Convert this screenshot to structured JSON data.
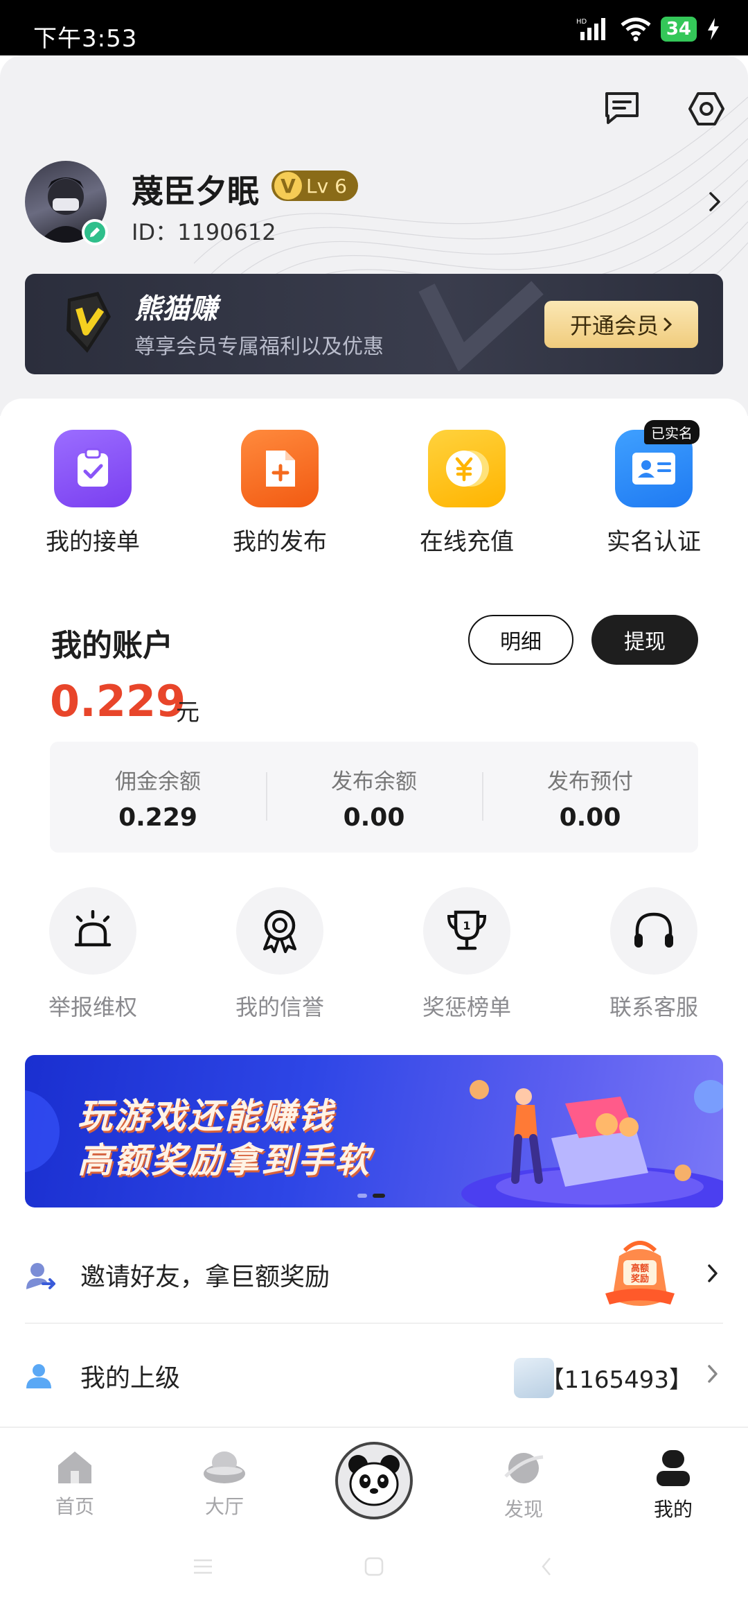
{
  "status_bar": {
    "time": "下午3:53",
    "battery": "34"
  },
  "profile": {
    "name": "蔑臣夕眠",
    "level": "Lv 6",
    "vip_letter": "V",
    "id_label": "ID：1190612"
  },
  "vip": {
    "title": "熊猫赚",
    "subtitle": "尊享会员专属福利以及优惠",
    "button": "开通会员"
  },
  "quick_actions": [
    {
      "label": "我的接单",
      "icon": "clipboard-check-icon"
    },
    {
      "label": "我的发布",
      "icon": "document-add-icon"
    },
    {
      "label": "在线充值",
      "icon": "yuan-coin-icon"
    },
    {
      "label": "实名认证",
      "icon": "id-card-icon",
      "tag": "已实名"
    }
  ],
  "account": {
    "title": "我的账户",
    "amount": "0.229",
    "unit": "元",
    "detail_button": "明细",
    "withdraw_button": "提现",
    "balances": [
      {
        "label": "佣金余额",
        "value": "0.229"
      },
      {
        "label": "发布余额",
        "value": "0.00"
      },
      {
        "label": "发布预付",
        "value": "0.00"
      }
    ]
  },
  "tools": [
    {
      "label": "举报维权",
      "icon": "alarm-icon"
    },
    {
      "label": "我的信誉",
      "icon": "medal-icon"
    },
    {
      "label": "奖惩榜单",
      "icon": "trophy-icon"
    },
    {
      "label": "联系客服",
      "icon": "headset-icon"
    }
  ],
  "banner": {
    "line1": "玩游戏还能赚钱",
    "line2": "高额奖励拿到手软"
  },
  "rows": {
    "invite": "邀请好友，拿巨额奖励",
    "invite_badge": "高额奖励",
    "upper": "我的上级",
    "upper_id": "【1165493】"
  },
  "tabs": [
    {
      "label": "首页",
      "icon": "home-icon"
    },
    {
      "label": "大厅",
      "icon": "ingot-icon"
    },
    {
      "label": "发现",
      "icon": "planet-icon"
    },
    {
      "label": "我的",
      "icon": "user-icon"
    }
  ],
  "colors": {
    "accent_red": "#e8452a",
    "dark": "#1e1e1e",
    "gold": "#f0cc7d"
  }
}
